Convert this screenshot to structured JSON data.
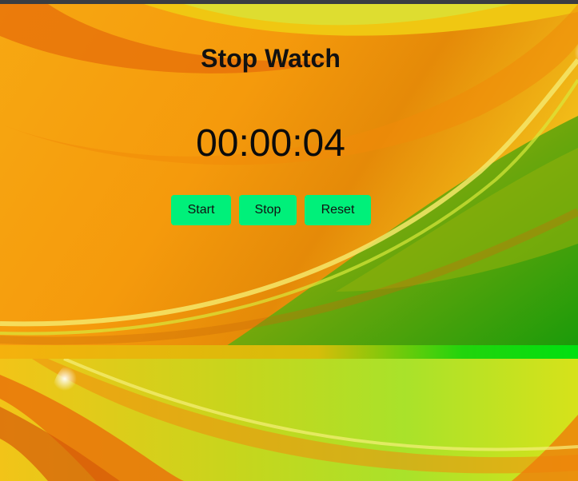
{
  "app": {
    "title": "Stop Watch",
    "time_display": "00:00:04"
  },
  "controls": {
    "start_label": "Start",
    "stop_label": "Stop",
    "reset_label": "Reset"
  },
  "colors": {
    "button_bg": "#00f07a",
    "top_bar": "#3a3d42",
    "background_orange": "#f59e0b",
    "background_green": "#3fa010"
  },
  "background": {
    "image": "orange-green-swoosh-wallpaper"
  }
}
